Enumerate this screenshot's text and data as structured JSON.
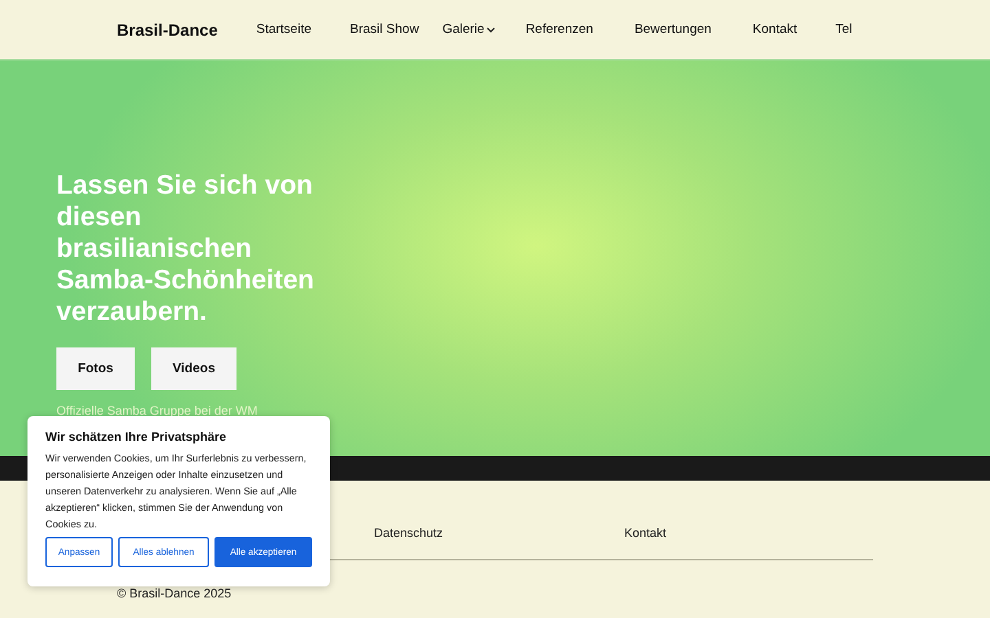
{
  "header": {
    "logo": "Brasil-Dance",
    "nav": [
      {
        "label": "Startseite",
        "has_submenu": false
      },
      {
        "label": "Brasil Show",
        "has_submenu": false
      },
      {
        "label": "Galerie",
        "has_submenu": true
      },
      {
        "label": "Referenzen",
        "has_submenu": false
      },
      {
        "label": "Bewertungen",
        "has_submenu": false
      },
      {
        "label": "Kontakt",
        "has_submenu": false
      },
      {
        "label": "Tel",
        "has_submenu": false
      }
    ]
  },
  "hero": {
    "title": "Lassen Sie sich von diesen brasilianischen Samba-Schönheiten verzaubern.",
    "buttons": [
      "Fotos",
      "Videos"
    ],
    "subtitle": "Offizielle Samba Gruppe bei der WM"
  },
  "footer": {
    "links": [
      "Datenschutz",
      "Kontakt"
    ],
    "copyright": "© Brasil-Dance 2025"
  },
  "cookie_dialog": {
    "title": "Wir schätzen Ihre Privatsphäre",
    "text": "Wir verwenden Cookies, um Ihr Surferlebnis zu verbessern, personalisierte Anzeigen oder Inhalte einzusetzen und unseren Datenverkehr zu analysieren. Wenn Sie auf „Alle akzeptieren“ klicken, stimmen Sie der Anwendung von Cookies zu.",
    "buttons": [
      {
        "label": "Anpassen",
        "kind": "outline"
      },
      {
        "label": "Alles ablehnen",
        "kind": "outline"
      },
      {
        "label": "Alle akzeptieren",
        "kind": "primary"
      }
    ]
  }
}
